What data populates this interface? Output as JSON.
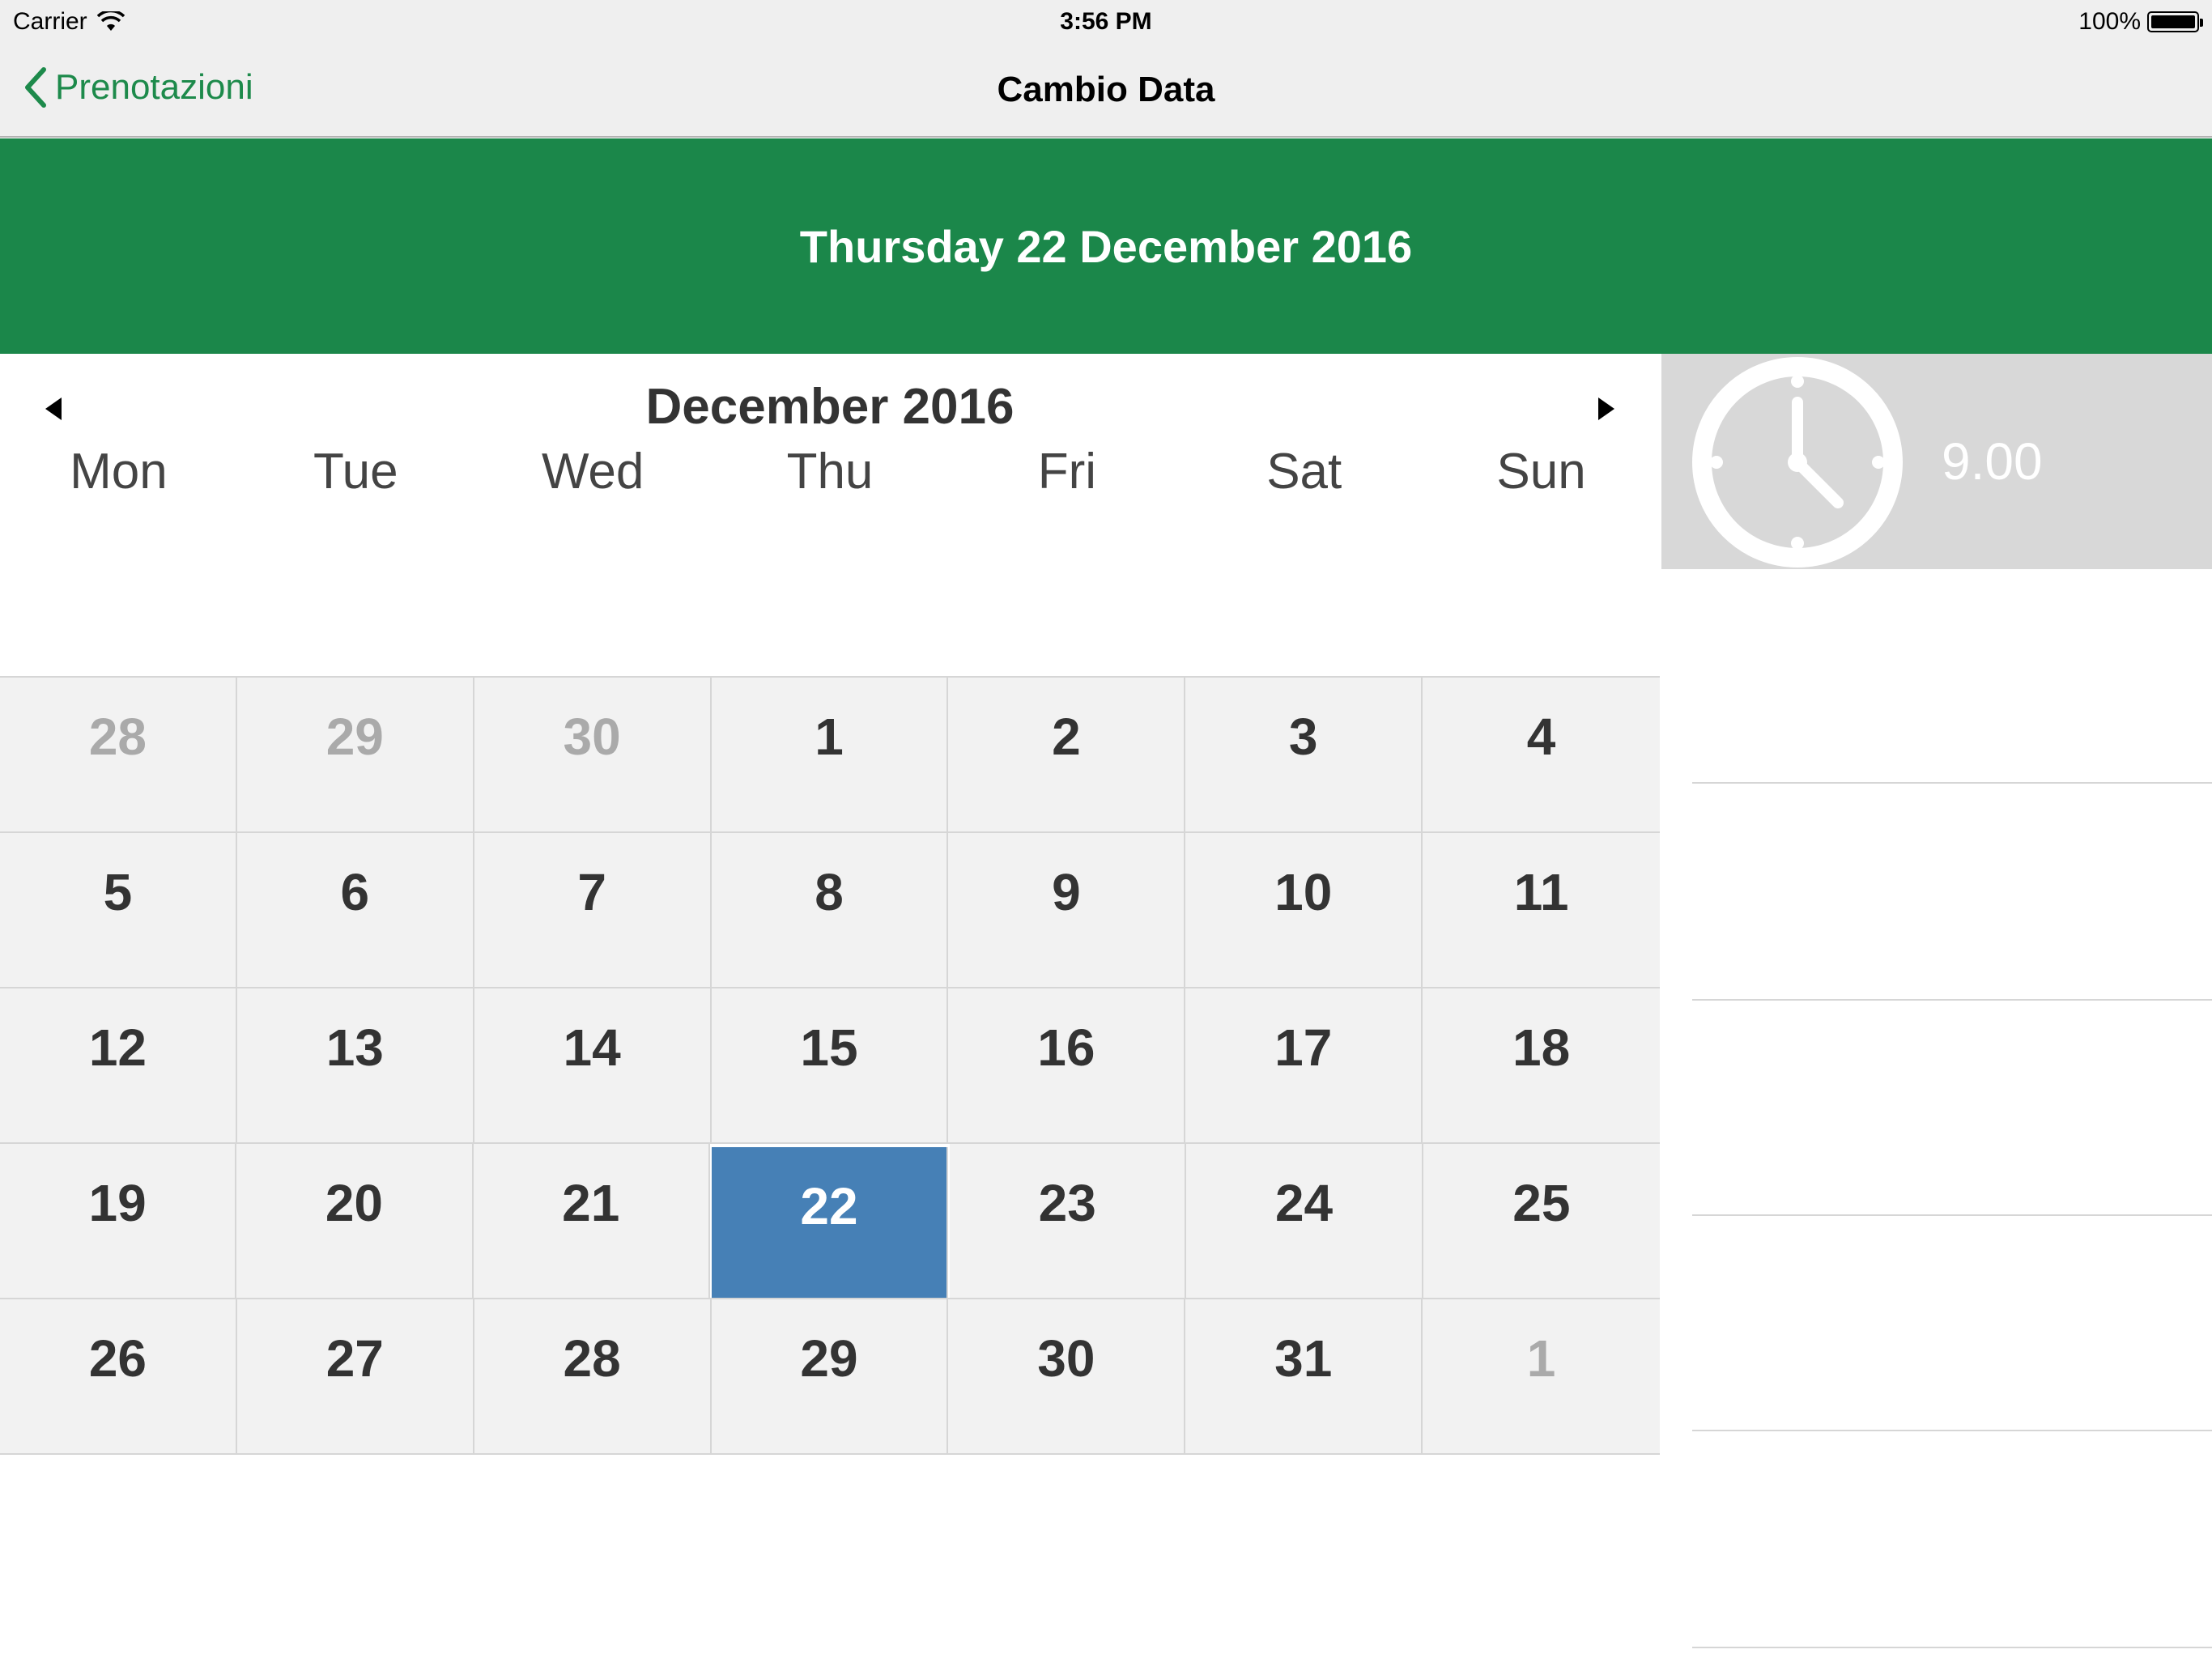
{
  "status_bar": {
    "carrier": "Carrier",
    "time": "3:56 PM",
    "battery": "100%"
  },
  "nav": {
    "back_label": "Prenotazioni",
    "title": "Cambio Data"
  },
  "selected_date_label": "Thursday 22 December 2016",
  "calendar": {
    "month_label": "December 2016",
    "weekdays": [
      "Mon",
      "Tue",
      "Wed",
      "Thu",
      "Fri",
      "Sat",
      "Sun"
    ],
    "weeks": [
      [
        {
          "d": "28",
          "other": true
        },
        {
          "d": "29",
          "other": true
        },
        {
          "d": "30",
          "other": true
        },
        {
          "d": "1"
        },
        {
          "d": "2"
        },
        {
          "d": "3"
        },
        {
          "d": "4"
        }
      ],
      [
        {
          "d": "5"
        },
        {
          "d": "6"
        },
        {
          "d": "7"
        },
        {
          "d": "8"
        },
        {
          "d": "9"
        },
        {
          "d": "10"
        },
        {
          "d": "11"
        }
      ],
      [
        {
          "d": "12"
        },
        {
          "d": "13"
        },
        {
          "d": "14"
        },
        {
          "d": "15"
        },
        {
          "d": "16"
        },
        {
          "d": "17"
        },
        {
          "d": "18"
        }
      ],
      [
        {
          "d": "19"
        },
        {
          "d": "20"
        },
        {
          "d": "21"
        },
        {
          "d": "22",
          "selected": true
        },
        {
          "d": "23"
        },
        {
          "d": "24"
        },
        {
          "d": "25"
        }
      ],
      [
        {
          "d": "26"
        },
        {
          "d": "27"
        },
        {
          "d": "28"
        },
        {
          "d": "29"
        },
        {
          "d": "30"
        },
        {
          "d": "31"
        },
        {
          "d": "1",
          "other": true
        }
      ]
    ]
  },
  "time_slot": {
    "value": "9.00",
    "icon": "clock-icon"
  },
  "colors": {
    "accent_green": "#1b874a",
    "selected_blue": "#4680b6",
    "nav_tint": "#1d8a4b"
  }
}
